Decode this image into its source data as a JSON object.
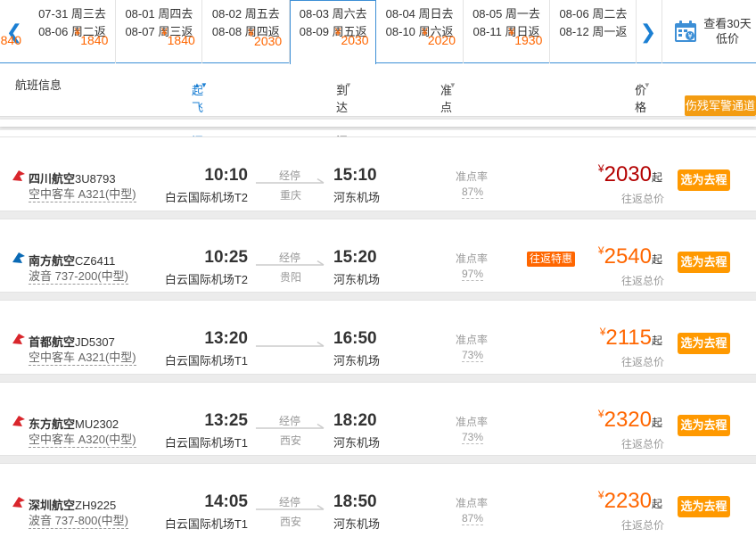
{
  "date_strip": {
    "prev_icon": "chevron-left-icon",
    "next_icon": "chevron-right-icon",
    "dates": [
      {
        "go": "07-31 周三去",
        "back": "08-06 周二返",
        "price": "1840",
        "active": false
      },
      {
        "go": "08-01 周四去",
        "back": "08-07 周三返",
        "price": "1840",
        "active": false
      },
      {
        "go": "08-02 周五去",
        "back": "08-08 周四返",
        "price": "1840",
        "active": false
      },
      {
        "go": "08-03 周六去",
        "back": "08-09 周五返",
        "price": "2030",
        "active": true
      },
      {
        "go": "08-04 周日去",
        "back": "08-10 周六返",
        "price": "2030",
        "active": false
      },
      {
        "go": "08-05 周一去",
        "back": "08-11 周日返",
        "price": "2020",
        "active": false
      },
      {
        "go": "08-06 周二去",
        "back": "08-12 周一返",
        "price": "1930",
        "active": false
      }
    ],
    "calendar_icon": "calendar-icon",
    "calendar_line1": "查看30天",
    "calendar_line2": "低价",
    "yen": "¥"
  },
  "header": {
    "flight_info": "航班信息",
    "departure_time": "起飞时间",
    "arrival_time": "到达时间",
    "ontime_rate": "准点率",
    "price": "价格",
    "sort_glyph": "▲▼",
    "military_channel": "伤残军警通道"
  },
  "labels": {
    "stop": "经停",
    "ontime": "准点率",
    "qi": "起",
    "roundtrip_total": "往返总价",
    "select": "选为去程",
    "yen": "¥"
  },
  "flights": [
    {
      "airline": "四川航空",
      "code": "3U8793",
      "aircraft": "空中客车 A321(中型)",
      "dep_time": "10:10",
      "dep_airport": "白云国际机场T2",
      "stop": "重庆",
      "arr_time": "15:10",
      "arr_airport": "河东机场",
      "ontime": "87%",
      "promo": "",
      "price": "2030",
      "logo_color": "#d9262c",
      "dark_price": true
    },
    {
      "airline": "南方航空",
      "code": "CZ6411",
      "aircraft": "波音 737-200(中型)",
      "dep_time": "10:25",
      "dep_airport": "白云国际机场T2",
      "stop": "贵阳",
      "arr_time": "15:20",
      "arr_airport": "河东机场",
      "ontime": "97%",
      "promo": "往返特惠",
      "price": "2540",
      "logo_color": "#0a6ab5",
      "dark_price": false
    },
    {
      "airline": "首都航空",
      "code": "JD5307",
      "aircraft": "空中客车 A321(中型)",
      "dep_time": "13:20",
      "dep_airport": "白云国际机场T1",
      "stop": "",
      "arr_time": "16:50",
      "arr_airport": "河东机场",
      "ontime": "73%",
      "promo": "",
      "price": "2115",
      "logo_color": "#d9262c",
      "dark_price": false
    },
    {
      "airline": "东方航空",
      "code": "MU2302",
      "aircraft": "空中客车 A320(中型)",
      "dep_time": "13:25",
      "dep_airport": "白云国际机场T1",
      "stop": "西安",
      "arr_time": "18:20",
      "arr_airport": "河东机场",
      "ontime": "73%",
      "promo": "",
      "price": "2320",
      "logo_color": "#d9262c",
      "dark_price": false
    },
    {
      "airline": "深圳航空",
      "code": "ZH9225",
      "aircraft": "波音 737-800(中型)",
      "dep_time": "14:05",
      "dep_airport": "白云国际机场T1",
      "stop": "西安",
      "arr_time": "18:50",
      "arr_airport": "河东机场",
      "ontime": "87%",
      "promo": "",
      "price": "2230",
      "logo_color": "#d9262c",
      "dark_price": false
    }
  ]
}
